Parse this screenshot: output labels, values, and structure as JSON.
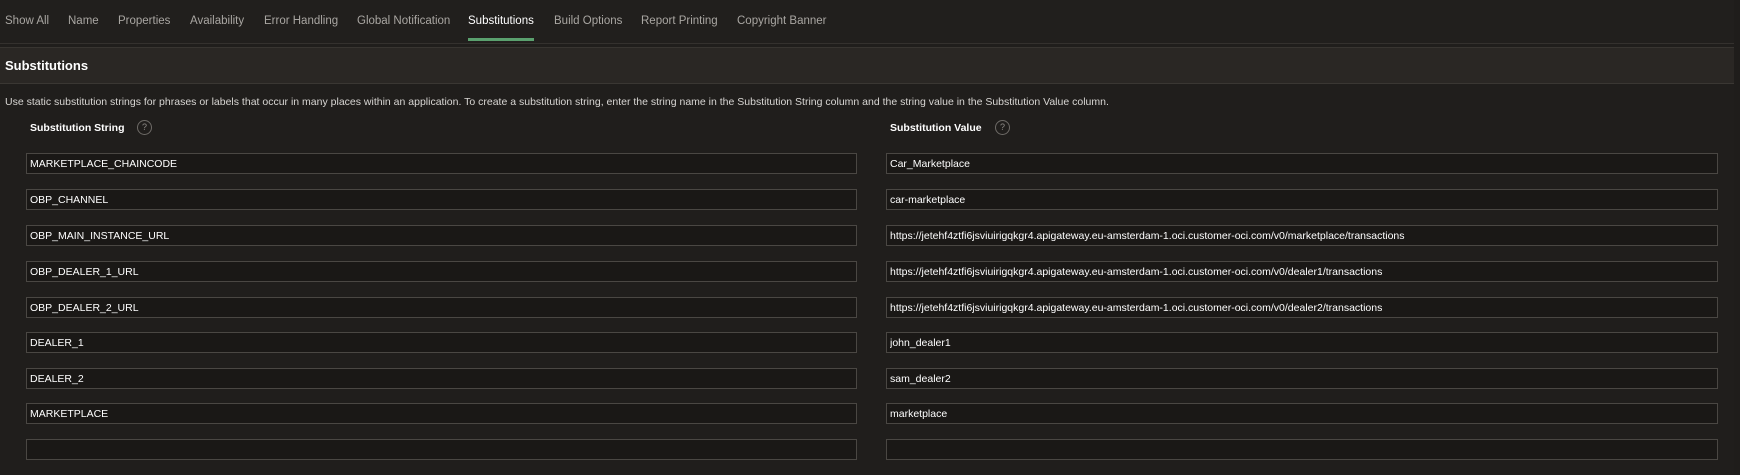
{
  "tabs": [
    {
      "label": "Show All",
      "active": false
    },
    {
      "label": "Name",
      "active": false
    },
    {
      "label": "Properties",
      "active": false
    },
    {
      "label": "Availability",
      "active": false
    },
    {
      "label": "Error Handling",
      "active": false
    },
    {
      "label": "Global Notification",
      "active": false
    },
    {
      "label": "Substitutions",
      "active": true
    },
    {
      "label": "Build Options",
      "active": false
    },
    {
      "label": "Report Printing",
      "active": false
    },
    {
      "label": "Copyright Banner",
      "active": false
    }
  ],
  "region": {
    "title": "Substitutions",
    "help_text": "Use static substitution strings for phrases or labels that occur in many places within an application. To create a substitution string, enter the string name in the Substitution String column and the string value in the Substitution Value column.",
    "help_icon": "question-circle-icon"
  },
  "columns": {
    "string_header": "Substitution String",
    "value_header": "Substitution Value"
  },
  "rows": [
    {
      "string": "MARKETPLACE_CHAINCODE",
      "value": "Car_Marketplace"
    },
    {
      "string": "OBP_CHANNEL",
      "value": "car-marketplace"
    },
    {
      "string": "OBP_MAIN_INSTANCE_URL",
      "value": "https://jetehf4ztfi6jsviuirigqkgr4.apigateway.eu-amsterdam-1.oci.customer-oci.com/v0/marketplace/transactions"
    },
    {
      "string": "OBP_DEALER_1_URL",
      "value": "https://jetehf4ztfi6jsviuirigqkgr4.apigateway.eu-amsterdam-1.oci.customer-oci.com/v0/dealer1/transactions"
    },
    {
      "string": "OBP_DEALER_2_URL",
      "value": "https://jetehf4ztfi6jsviuirigqkgr4.apigateway.eu-amsterdam-1.oci.customer-oci.com/v0/dealer2/transactions"
    },
    {
      "string": "DEALER_1",
      "value": "john_dealer1"
    },
    {
      "string": "DEALER_2",
      "value": "sam_dealer2"
    },
    {
      "string": "MARKETPLACE",
      "value": "marketplace"
    },
    {
      "string": "",
      "value": ""
    }
  ],
  "colors": {
    "background": "#201e1c",
    "active_tab_underline": "#5aa06e",
    "field_border": "#4a4743"
  }
}
